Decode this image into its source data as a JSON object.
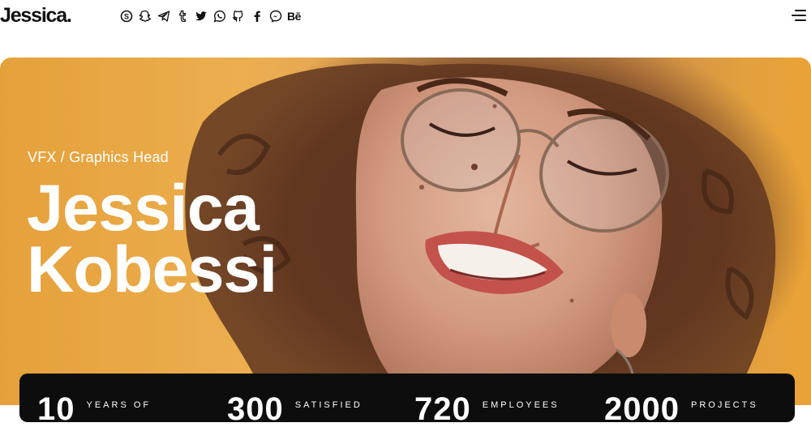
{
  "header": {
    "logo": "Jessica.",
    "social": [
      {
        "icon": "skype-icon"
      },
      {
        "icon": "snapchat-icon"
      },
      {
        "icon": "telegram-icon"
      },
      {
        "icon": "tumblr-icon"
      },
      {
        "icon": "twitter-icon"
      },
      {
        "icon": "whatsapp-icon"
      },
      {
        "icon": "github-icon"
      },
      {
        "icon": "facebook-icon"
      },
      {
        "icon": "messenger-icon"
      },
      {
        "icon": "behance-icon",
        "label": "Bē"
      }
    ],
    "menu_icon": "hamburger-menu-icon"
  },
  "hero": {
    "role": "VFX / Graphics Head",
    "first_name": "Jessica",
    "last_name": "Kobessi",
    "background_color": "#efac45"
  },
  "stats": [
    {
      "number": "10",
      "label": "YEARS OF"
    },
    {
      "number": "300",
      "label": "SATISFIED"
    },
    {
      "number": "720",
      "label": "EMPLOYEES"
    },
    {
      "number": "2000",
      "label": "PROJECTS"
    }
  ]
}
